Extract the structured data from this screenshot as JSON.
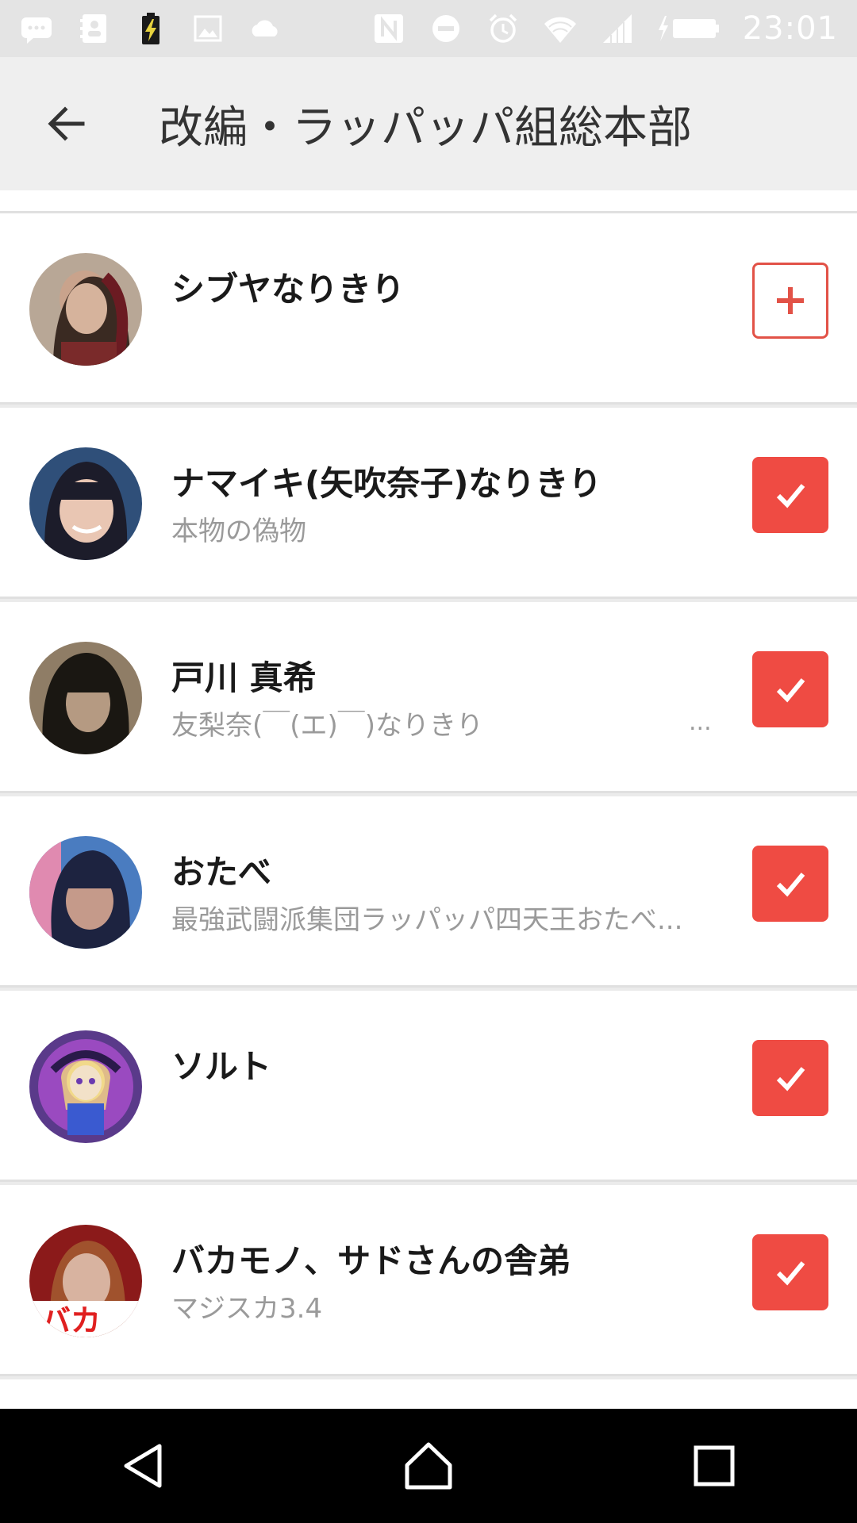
{
  "status_bar": {
    "time": "23:01",
    "left_icons": [
      "message-icon",
      "contact-card-icon",
      "battery-charging-icon",
      "image-icon",
      "cloud-icon"
    ],
    "right_icons": [
      "nfc-icon",
      "do-not-disturb-icon",
      "alarm-icon",
      "wifi-icon",
      "signal-icon",
      "battery-icon"
    ]
  },
  "app_bar": {
    "title": "改編・ラッパッパ組総本部",
    "back_icon": "arrow-left-icon"
  },
  "colors": {
    "accent": "#ef4b43",
    "status_bar_bg": "#e4e4e4",
    "app_bar_bg": "#efefef",
    "row_bg": "#ffffff",
    "secondary_text": "#9a9a9a"
  },
  "list": {
    "items": [
      {
        "name": "シブヤなりきり",
        "subtitle": "",
        "action": "add",
        "avatar_colors": [
          "#3a2a22",
          "#c9a38c",
          "#6b1b22"
        ]
      },
      {
        "name": "ナマイキ(矢吹奈子)なりきり",
        "subtitle": "本物の偽物",
        "action": "checked",
        "avatar_colors": [
          "#2f4f79",
          "#e9c6b3",
          "#1c1c2a"
        ]
      },
      {
        "name": "戸川 真希",
        "subtitle": "友梨奈(￣(エ)￣)なりきり",
        "subtitle_ellipsis": "...",
        "action": "checked",
        "avatar_colors": [
          "#1a1712",
          "#8f7d66",
          "#3b3526"
        ]
      },
      {
        "name": "おたべ",
        "subtitle": "最強武闘派集団ラッパッパ四天王おたべ...",
        "action": "checked",
        "avatar_colors": [
          "#1d2340",
          "#c59a8a",
          "#4a7cc0"
        ]
      },
      {
        "name": "ソルト",
        "subtitle": "",
        "action": "checked",
        "avatar_colors": [
          "#5a3a8a",
          "#f2e1c8",
          "#9a4ac0"
        ]
      },
      {
        "name": "バカモノ、サドさんの舎弟",
        "subtitle": "マジスカ3.4",
        "action": "checked",
        "avatar_colors": [
          "#8b1a1a",
          "#d8b3a0",
          "#e02020"
        ]
      }
    ]
  },
  "nav_bar": {
    "buttons": [
      "back-triangle-icon",
      "home-icon",
      "recents-icon"
    ]
  }
}
